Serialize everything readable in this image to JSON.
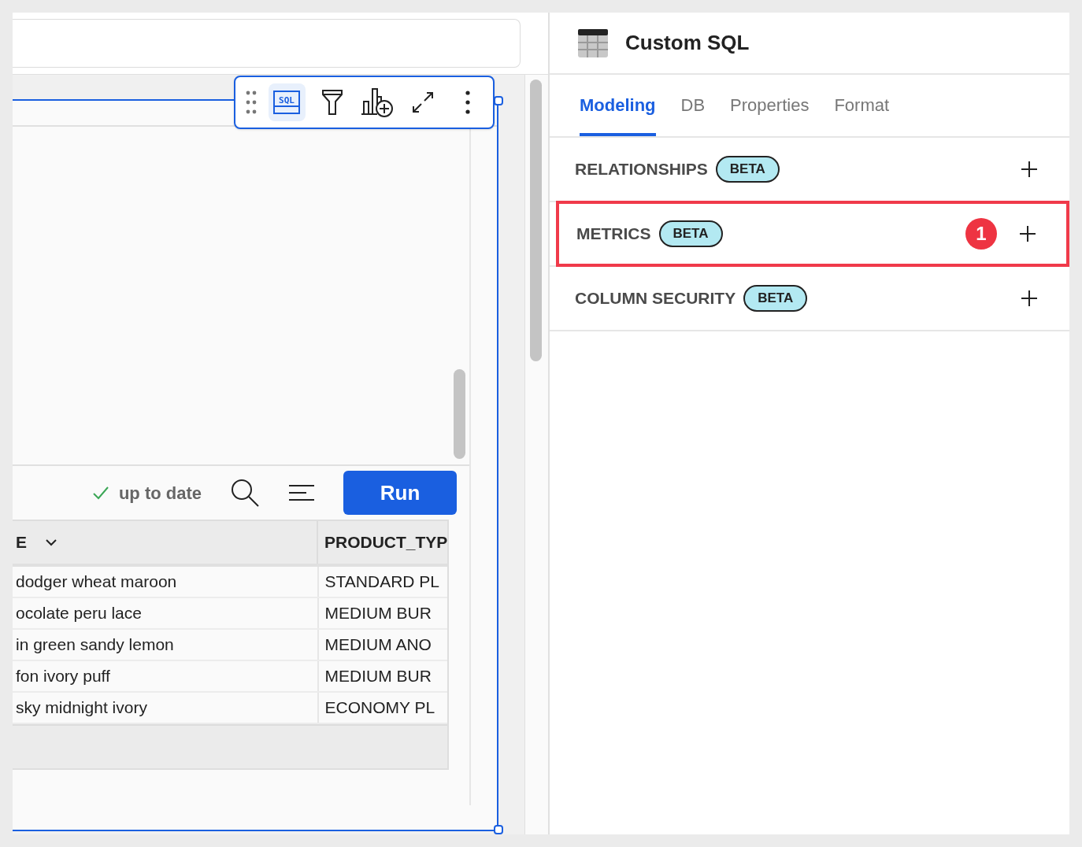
{
  "editor": {
    "status": "up to date",
    "run_button": "Run",
    "toolbar": [
      {
        "kind": "drag"
      },
      {
        "kind": "sql",
        "label": "SQL",
        "selected": true
      },
      {
        "kind": "filter",
        "selected": false
      },
      {
        "kind": "chart",
        "selected": false
      },
      {
        "kind": "expand",
        "selected": false
      },
      {
        "kind": "more",
        "selected": false
      }
    ]
  },
  "table": {
    "columns": [
      {
        "label": "E",
        "sortable": true
      },
      {
        "label": "PRODUCT_TYP"
      }
    ],
    "rows": [
      [
        "dodger wheat maroon",
        "STANDARD PL"
      ],
      [
        "ocolate peru lace",
        "MEDIUM BUR"
      ],
      [
        "in green sandy lemon",
        "MEDIUM ANO"
      ],
      [
        "fon ivory puff",
        "MEDIUM BUR"
      ],
      [
        "sky midnight ivory",
        "ECONOMY PL"
      ]
    ]
  },
  "panel": {
    "title": "Custom SQL",
    "tabs": [
      {
        "label": "Modeling",
        "selected": true
      },
      {
        "label": "DB",
        "selected": false
      },
      {
        "label": "Properties",
        "selected": false
      },
      {
        "label": "Format",
        "selected": false
      }
    ],
    "sections": [
      {
        "label": "RELATIONSHIPS",
        "badge": "BETA",
        "highlighted": false
      },
      {
        "label": "METRICS",
        "badge": "BETA",
        "highlighted": true,
        "callout": "1"
      },
      {
        "label": "COLUMN SECURITY",
        "badge": "BETA",
        "highlighted": false
      }
    ]
  }
}
